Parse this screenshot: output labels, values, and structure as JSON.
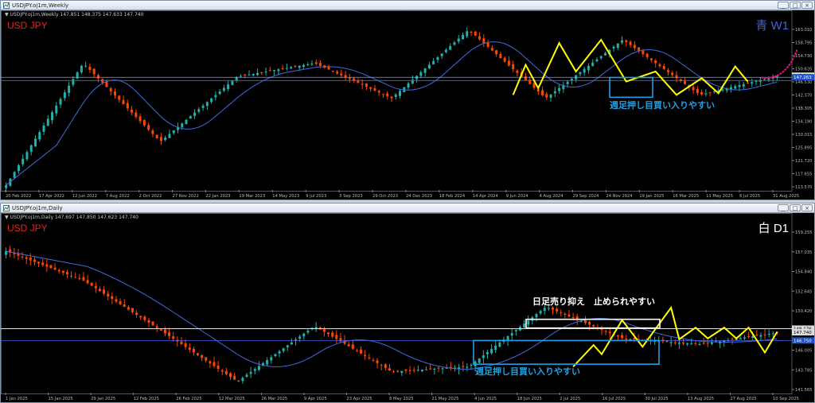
{
  "top_window": {
    "title": "USDJPY.oj1m,Weekly",
    "header_info": "▼ USDJPY.oj1m,Weekly  147.851 148.375 147.633 147.740",
    "symbol_label": "USD JPY",
    "timeframe_label": "青 W1",
    "annotation": "週足押し目買い入りやすい",
    "price_axis": [
      "163.010",
      "158.795",
      "154.730",
      "150.620",
      "146.530",
      "142.370",
      "138.305",
      "134.190",
      "130.015",
      "125.895",
      "121.720",
      "117.655",
      "113.570"
    ],
    "price_markers": [
      "147.740",
      "147.263"
    ],
    "time_axis": [
      "20 Feb 2022",
      "17 Apr 2022",
      "12 Jun 2022",
      "7 Aug 2022",
      "2 Oct 2022",
      "27 Nov 2022",
      "22 Jan 2023",
      "19 Mar 2023",
      "14 May 2023",
      "9 Jul 2023",
      "3 Sep 2023",
      "29 Oct 2023",
      "24 Dec 2023",
      "18 Feb 2024",
      "14 Apr 2024",
      "9 Jun 2024",
      "4 Aug 2024",
      "29 Sep 2024",
      "24 Nov 2024",
      "19 Jan 2025",
      "16 Mar 2025",
      "11 May 2025",
      "6 Jul 2025",
      "31 Aug 2025"
    ],
    "price_range": [
      113.57,
      163.01
    ]
  },
  "bottom_window": {
    "title": "USDJPY.oj1m,Daily",
    "header_info": "▼ USDJPY.oj1m,Daily  147.697 147.850 147.623 147.740",
    "symbol_label": "USD JPY",
    "timeframe_label": "白 D1",
    "annotation_upper": "日足売り抑え　止められやすい",
    "annotation_lower": "週足押し目買い入りやすい",
    "price_axis": [
      "159.255",
      "157.035",
      "154.840",
      "152.645",
      "150.420",
      "148.225",
      "146.005",
      "143.785",
      "141.565"
    ],
    "price_markers": [
      "148.176",
      "147.740",
      "146.750"
    ],
    "time_axis": [
      "1 Jan 2025",
      "15 Jan 2025",
      "29 Jan 2025",
      "12 Feb 2025",
      "26 Feb 2025",
      "12 Mar 2025",
      "26 Mar 2025",
      "9 Apr 2025",
      "23 Apr 2025",
      "8 May 2025",
      "21 May 2025",
      "4 Jun 2025",
      "18 Jun 2025",
      "2 Jul 2025",
      "16 Jul 2025",
      "30 Jul 2025",
      "13 Aug 2025",
      "27 Aug 2025",
      "10 Sep 2025"
    ],
    "price_range": [
      140.47,
      160.37
    ]
  },
  "window_buttons": {
    "minimize": "_",
    "maximize": "□",
    "close": "×"
  },
  "colors": {
    "background": "#000000",
    "bull_candle": "#20b2aa",
    "bear_candle": "#ff4500",
    "ma_line": "#4169e1",
    "zigzag": "#ffff00",
    "projection": "#dc1478",
    "box_cyan": "#1ea0e6",
    "box_white": "#ffffff",
    "symbol_red": "#e0261e",
    "w1_blue": "#3c64dc"
  },
  "chart_data": [
    {
      "type": "candlestick",
      "title": "USDJPY Weekly",
      "key_points": [
        {
          "x": "20 Feb 2022",
          "y": 115
        },
        {
          "x": "2 Oct 2022",
          "y": 151.5
        },
        {
          "x": "22 Jan 2023",
          "y": 128
        },
        {
          "x": "3 Sep 2023",
          "y": 147.5
        },
        {
          "x": "29 Oct 2023",
          "y": 151.5
        },
        {
          "x": "24 Dec 2023",
          "y": 141
        },
        {
          "x": "9 Jun 2024",
          "y": 161.5
        },
        {
          "x": "29 Sep 2024",
          "y": 141
        },
        {
          "x": "19 Jan 2025",
          "y": 158.5
        },
        {
          "x": "11 May 2025",
          "y": 142
        },
        {
          "x": "31 Aug 2025",
          "y": 147.7
        }
      ],
      "ylim": [
        113.57,
        163.01
      ]
    },
    {
      "type": "candlestick",
      "title": "USDJPY Daily",
      "key_points": [
        {
          "x": "1 Jan 2025",
          "y": 157.5
        },
        {
          "x": "12 Feb 2025",
          "y": 154
        },
        {
          "x": "12 Mar 2025",
          "y": 148
        },
        {
          "x": "23 Apr 2025",
          "y": 141.8
        },
        {
          "x": "8 May 2025",
          "y": 148.5
        },
        {
          "x": "4 Jun 2025",
          "y": 143
        },
        {
          "x": "2 Jul 2025",
          "y": 143.6
        },
        {
          "x": "30 Jul 2025",
          "y": 150.8
        },
        {
          "x": "13 Aug 2025",
          "y": 147
        },
        {
          "x": "10 Sep 2025",
          "y": 146.3
        },
        {
          "x": "18 Sep 2025",
          "y": 147.7
        }
      ],
      "ylim": [
        140.47,
        160.37
      ]
    }
  ]
}
